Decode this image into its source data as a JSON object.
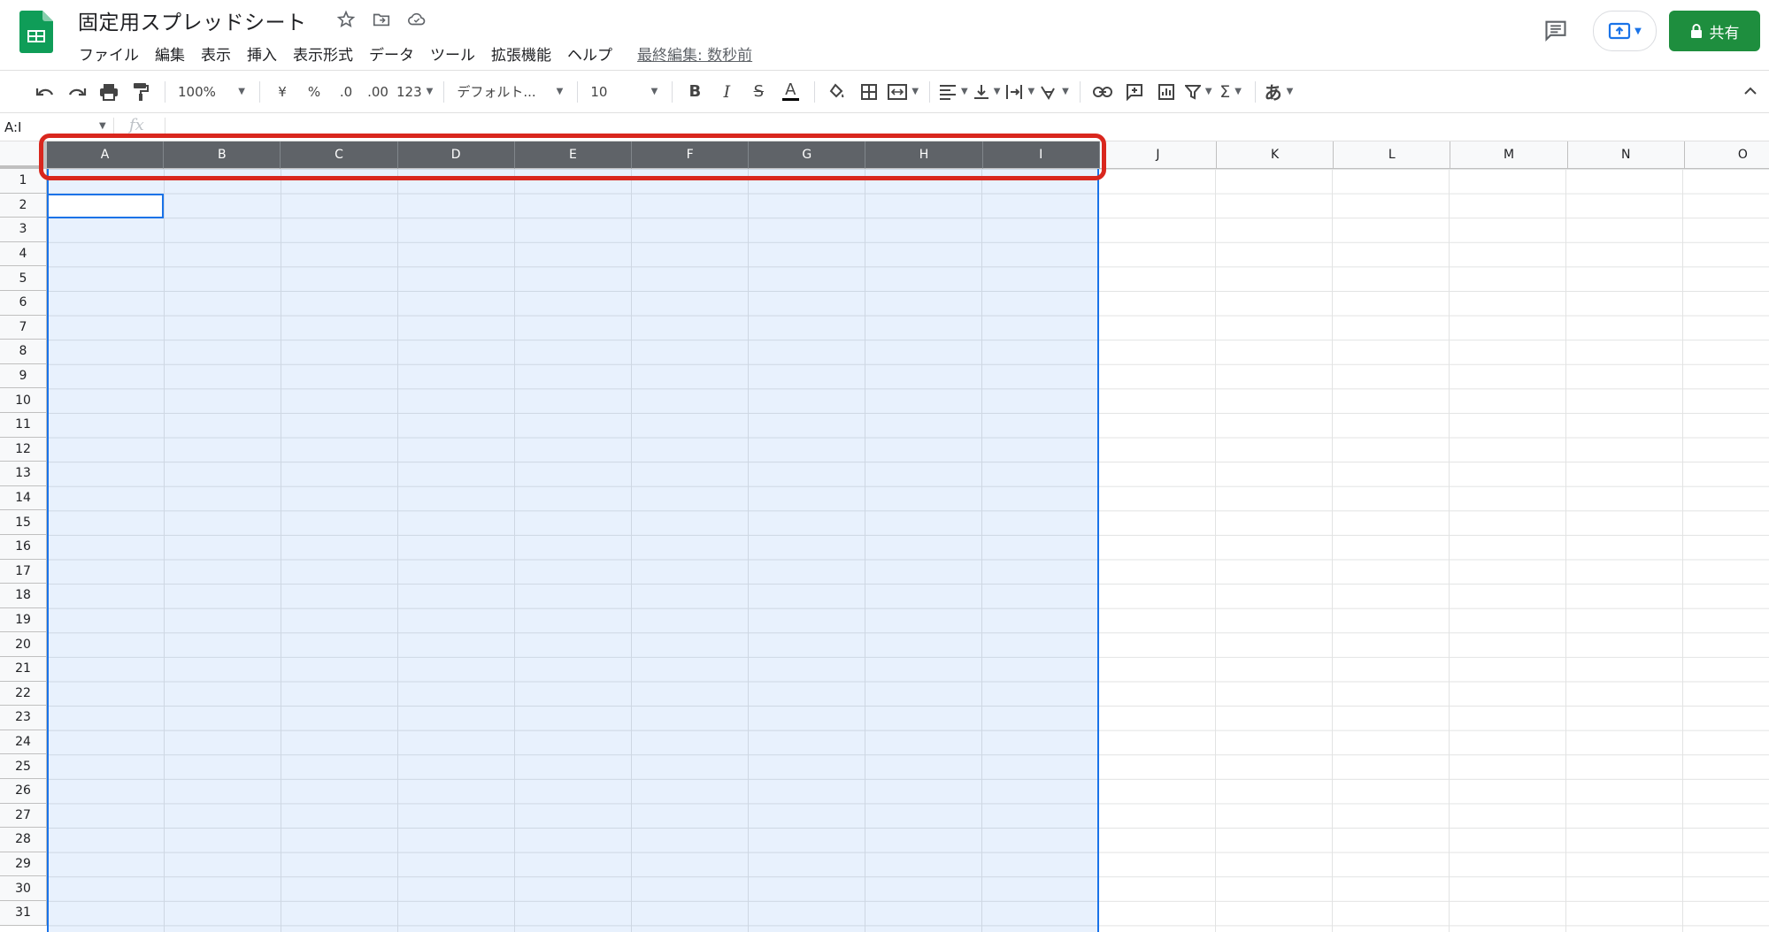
{
  "app": {
    "doc_title": "固定用スプレッドシート",
    "logo_icon": "sheets-logo-icon",
    "brand_color": "#0f9d58"
  },
  "title_icons": [
    "star-icon",
    "move-to-folder-icon",
    "cloud-status-icon"
  ],
  "menu": {
    "items": [
      "ファイル",
      "編集",
      "表示",
      "挿入",
      "表示形式",
      "データ",
      "ツール",
      "拡張機能",
      "ヘルプ"
    ],
    "last_edit": "最終編集: 数秒前"
  },
  "header_buttons": {
    "comment_icon": "comment-history-icon",
    "present_icon": "present-icon",
    "share_label": "共有",
    "share_icon": "lock-icon",
    "share_color": "#1e8e3e"
  },
  "toolbar": {
    "zoom": "100%",
    "currency": "¥",
    "percent": "%",
    "decrease_decimal": ".0",
    "increase_decimal": ".00",
    "more_formats": "123",
    "font": "デフォルト...",
    "font_size": "10",
    "input_tool": "あ"
  },
  "formula_bar": {
    "name_box": "A:I",
    "fx": "fx"
  },
  "grid": {
    "columns": [
      "A",
      "B",
      "C",
      "D",
      "E",
      "F",
      "G",
      "H",
      "I",
      "J",
      "K",
      "L",
      "M",
      "N",
      "O"
    ],
    "selected_columns": [
      "A",
      "B",
      "C",
      "D",
      "E",
      "F",
      "G",
      "H",
      "I"
    ],
    "rows": [
      "1",
      "2",
      "3",
      "4",
      "5",
      "6",
      "7",
      "8",
      "9",
      "10",
      "11",
      "12",
      "13",
      "14",
      "15",
      "16",
      "17",
      "18",
      "19",
      "20",
      "21",
      "22",
      "23",
      "24",
      "25",
      "26",
      "27",
      "28",
      "29",
      "30",
      "31"
    ],
    "active_cell": "A2",
    "selection_color": "#1a73e8",
    "highlight_color": "#d9271e"
  }
}
